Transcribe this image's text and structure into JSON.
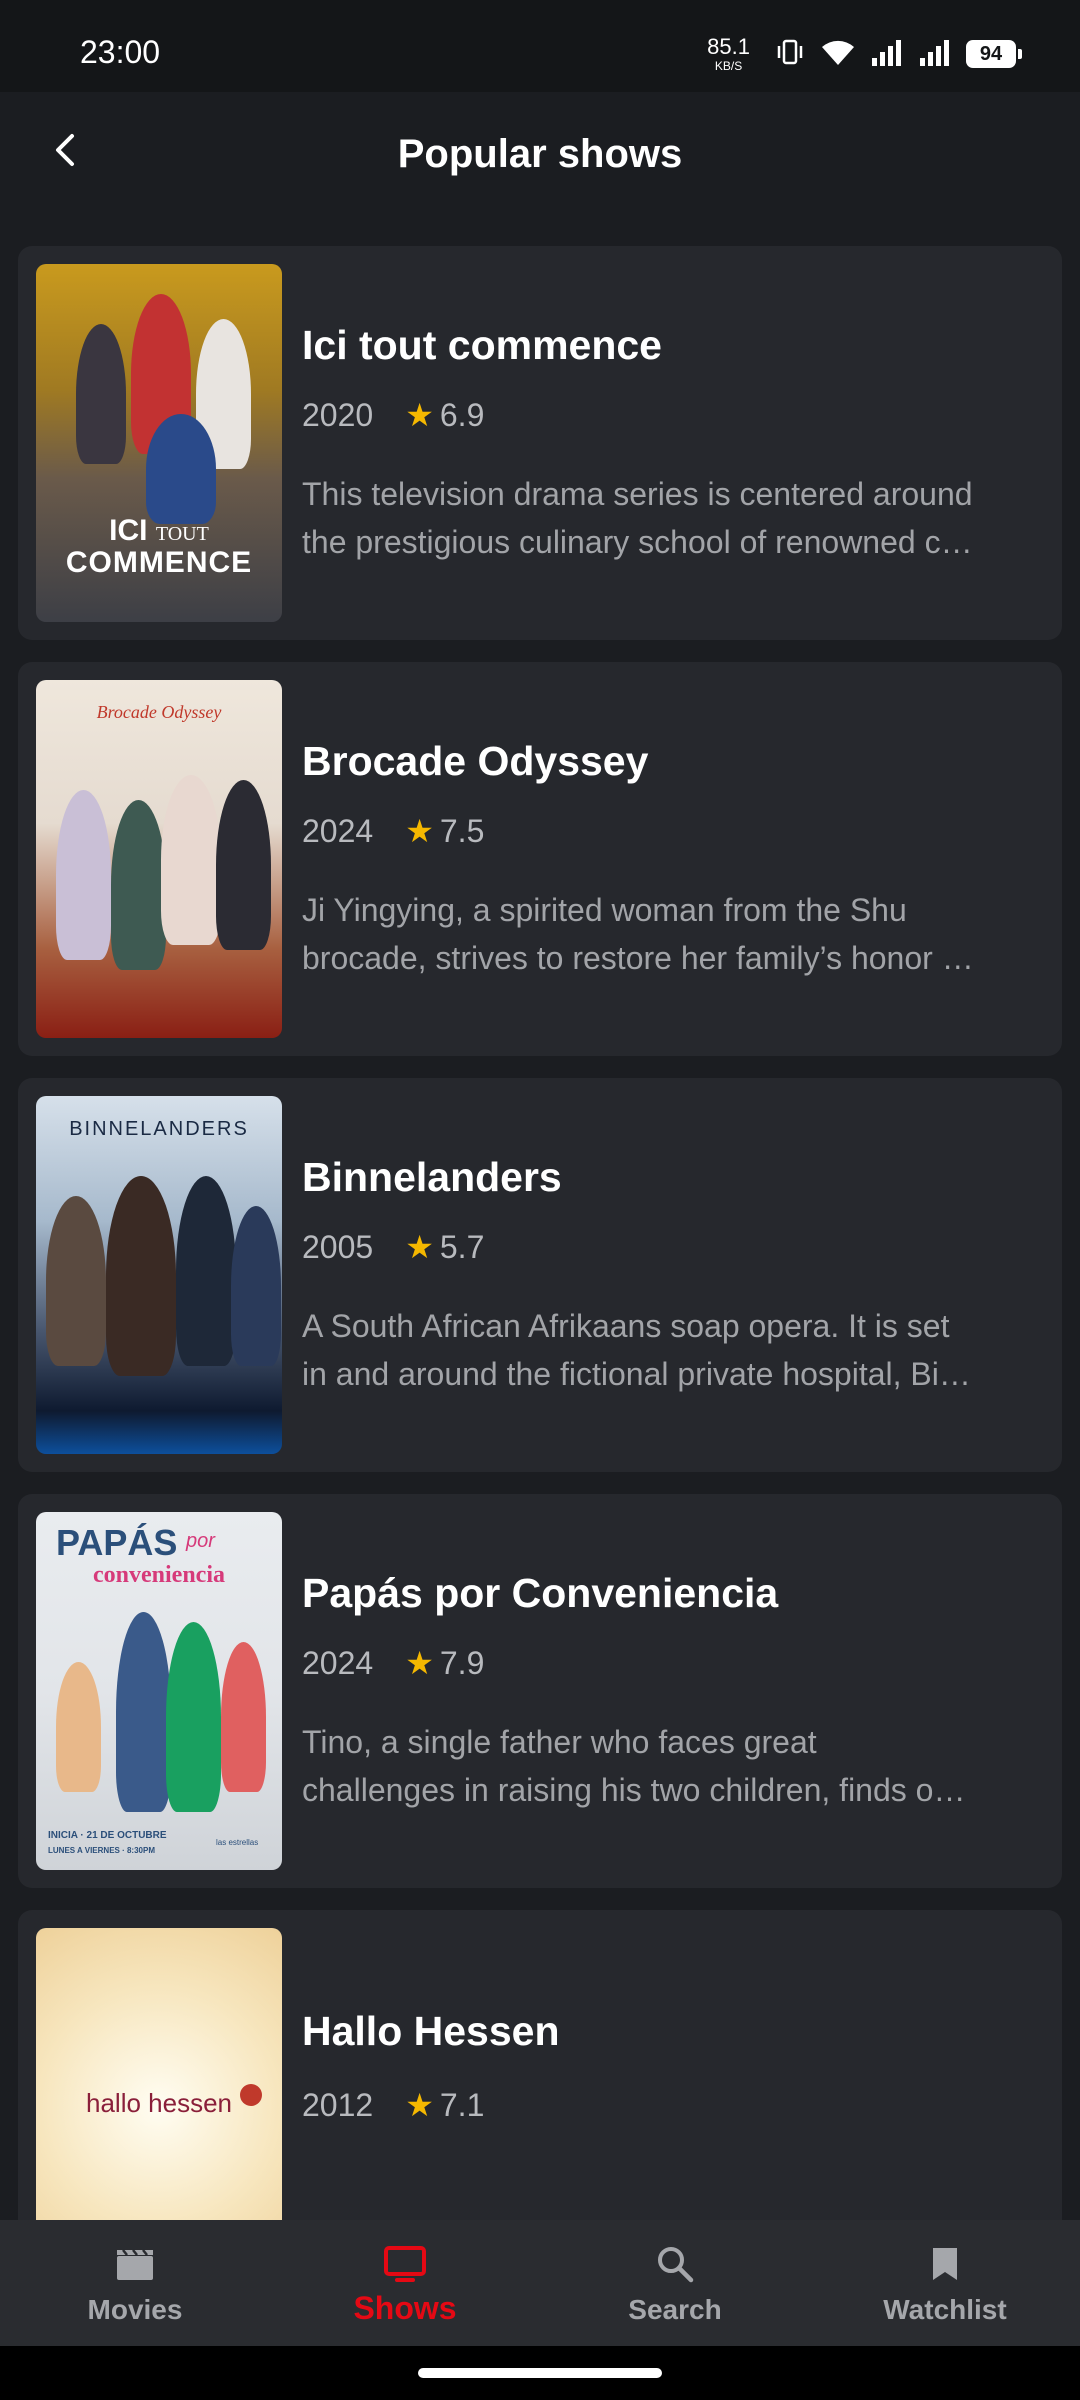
{
  "status_bar": {
    "time": "23:00",
    "net_speed": "85.1",
    "net_unit": "KB/S",
    "battery": "94"
  },
  "header": {
    "title": "Popular shows"
  },
  "shows": [
    {
      "title": "Ici tout commence",
      "year": "2020",
      "rating": "6.9",
      "overview_line1": "This television drama series is centered around",
      "overview_line2": "the prestigious culinary school of renowned c…",
      "poster_text_1": "ICI",
      "poster_text_2": "TOUT",
      "poster_text_3": "COMMENCE"
    },
    {
      "title": "Brocade Odyssey",
      "year": "2024",
      "rating": "7.5",
      "overview_line1": "Ji Yingying, a spirited woman from the Shu",
      "overview_line2": "brocade, strives to restore her family’s honor …",
      "poster_text_1": "Brocade Odyssey"
    },
    {
      "title": "Binnelanders",
      "year": "2005",
      "rating": "5.7",
      "overview_line1": "A South African Afrikaans soap opera. It is set",
      "overview_line2": "in and around the fictional private hospital, Bi…",
      "poster_text_1": "BINNELANDERS"
    },
    {
      "title": "Papás por Conveniencia",
      "year": "2024",
      "rating": "7.9",
      "overview_line1": "Tino, a single father who faces great",
      "overview_line2": "challenges in raising his two children, finds o…",
      "poster_text_1": "PAPÁS",
      "poster_text_2": "por",
      "poster_text_3": "conveniencia",
      "poster_text_4": "INICIA · 21 DE OCTUBRE",
      "poster_text_5": "LUNES A VIERNES · 8:30PM",
      "poster_text_6": "las estrellas"
    },
    {
      "title": "Hallo Hessen",
      "year": "2012",
      "rating": "7.1",
      "poster_text_1": "hallo hessen"
    }
  ],
  "bottom_nav": {
    "movies": "Movies",
    "shows": "Shows",
    "search": "Search",
    "watchlist": "Watchlist"
  },
  "colors": {
    "background": "#1b1d21",
    "card": "#26282d",
    "accent_active": "#e50914",
    "star": "#f5b800",
    "nav_bar": "#2a2c30"
  },
  "icons": {
    "back": "back-arrow-icon",
    "star": "star-icon",
    "movies": "clapperboard-icon",
    "shows": "tv-icon",
    "search": "search-icon",
    "watchlist": "bookmark-icon"
  }
}
